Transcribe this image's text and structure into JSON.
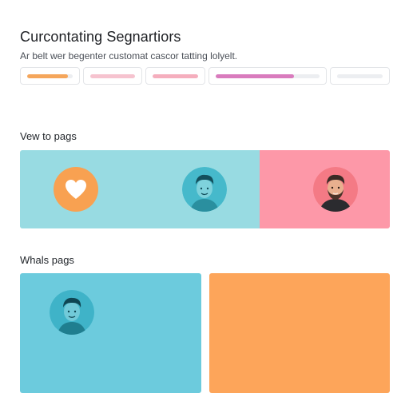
{
  "header": {
    "title": "Curcontating Segnartiors",
    "subtitle": "Ar belt wer begenter customat cascor tatting lolyelt."
  },
  "progress_tabs": [
    {
      "name": "tab-1",
      "fill": 0.9,
      "color": "#f5a65b"
    },
    {
      "name": "tab-2",
      "fill": 1.0,
      "color": "#f6c3cf"
    },
    {
      "name": "tab-3",
      "fill": 1.0,
      "color": "#f5aebd"
    },
    {
      "name": "tab-4",
      "fill": 0.75,
      "color": "#d97bbd"
    },
    {
      "name": "tab-5",
      "fill": 0.0,
      "color": "#eceef1"
    }
  ],
  "sections": {
    "first_label": "Vew to pags",
    "second_label": "Whals pags"
  },
  "colors": {
    "teal_light": "#98dbe2",
    "pink": "#fd98a8",
    "orange": "#f8a151",
    "teal": "#6ccbdd",
    "orange_card": "#fda55a"
  },
  "icons": {
    "heart": "heart-icon",
    "avatar_a": "avatar-man-teal",
    "avatar_b": "avatar-man-beard",
    "avatar_c": "avatar-man-teal-2"
  }
}
